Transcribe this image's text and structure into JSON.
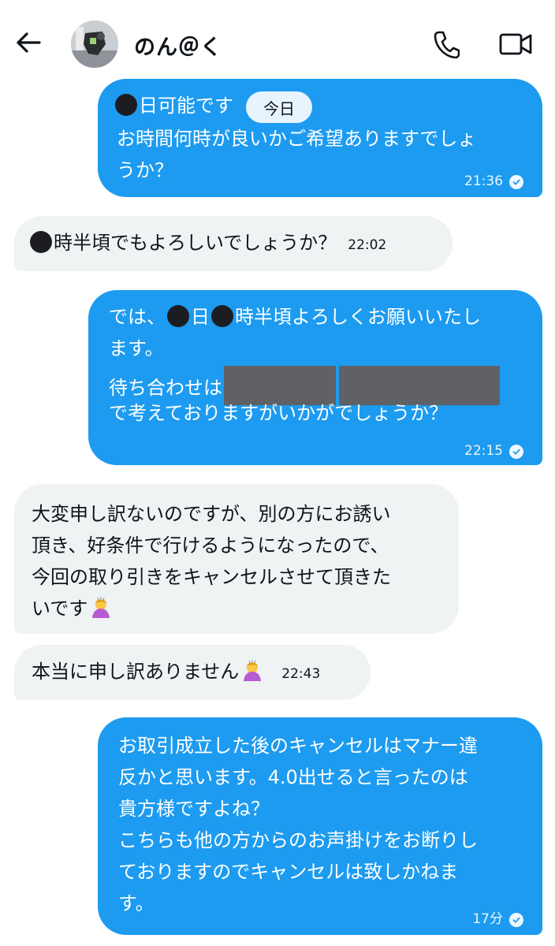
{
  "header": {
    "back_icon": "arrow-left-icon",
    "contact_name": "のん＠く",
    "call_icon": "phone-icon",
    "video_icon": "video-camera-icon"
  },
  "date_chip": "今日",
  "messages": [
    {
      "direction": "sent",
      "line1_after_dot": "日可能です",
      "line2": "お時間何時が良いかご希望ありますでしょ",
      "line3": "うか？",
      "time": "21:36",
      "status": "read"
    },
    {
      "direction": "received",
      "text_after_dot": "時半頃でもよろしいでしょうか？",
      "time": "22:02"
    },
    {
      "direction": "sent",
      "line1_prefix": "では、",
      "line1_mid": "日",
      "line1_end": "時半頃よろしくお願いいたし",
      "line2": "ます。",
      "line3": "待ち合わせは",
      "line4": "で考えておりますがいかがでしょうか？",
      "time": "22:15",
      "status": "read"
    },
    {
      "direction": "received",
      "text": "大変申し訳ないのですが、別の方にお誘い\n頂き、好条件で行けるようになったので、\n今回の取り引きをキャンセルさせて頂きた\nいです",
      "emoji": "person-bowing-emoji"
    },
    {
      "direction": "received",
      "text": "本当に申し訳ありません",
      "emoji": "person-bowing-emoji",
      "time": "22:43"
    },
    {
      "direction": "sent",
      "text": "お取引成立した後のキャンセルはマナー違\n反かと思います。4.0出せると言ったのは\n貴方様ですよね？\nこちらも他の方からのお声掛けをお断りし\nておりますのでキャンセルは致しかねま\nす。",
      "time": "17分",
      "status": "read"
    }
  ],
  "colors": {
    "sent_bubble": "#1d9bf0",
    "received_bubble": "#eff3f4",
    "redaction": "#5f6164"
  }
}
